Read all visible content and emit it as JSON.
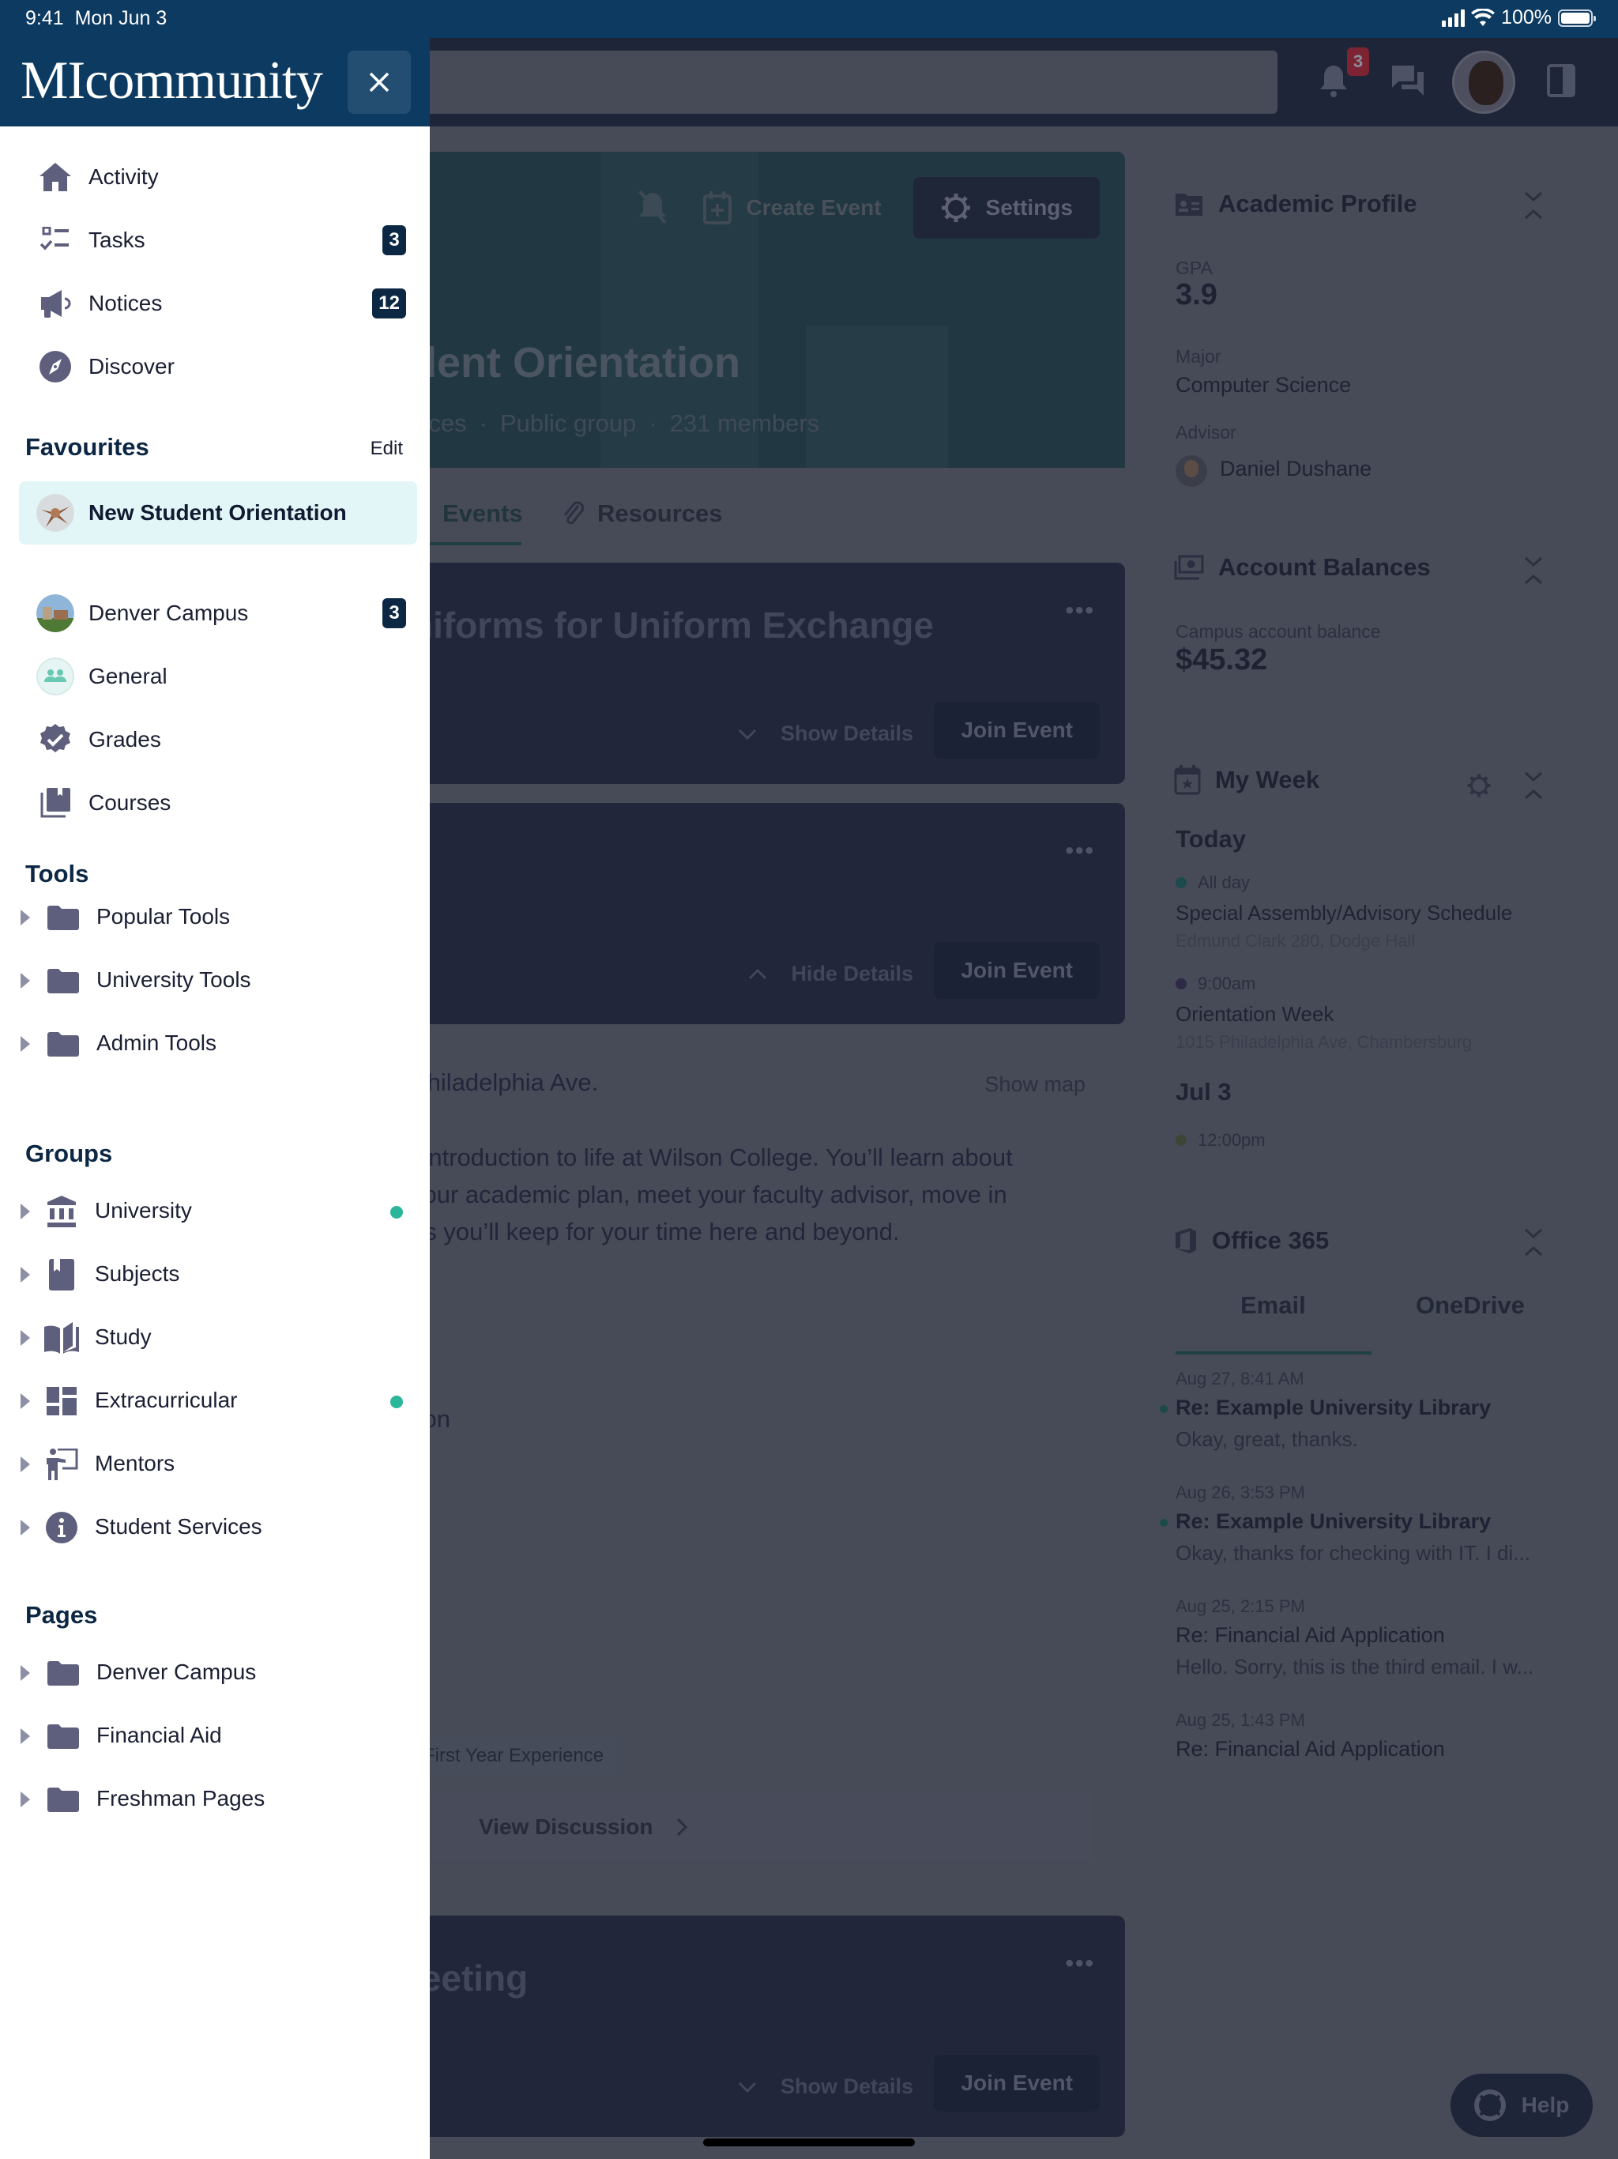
{
  "status_bar": {
    "time": "9:41",
    "date": "Mon Jun 3",
    "battery": "100%"
  },
  "drawer": {
    "brand": "MIcommunity",
    "close_label": "Close",
    "nav": [
      {
        "label": "Activity",
        "icon": "home-icon"
      },
      {
        "label": "Tasks",
        "icon": "task-list-icon",
        "badge": "3"
      },
      {
        "label": "Notices",
        "icon": "megaphone-icon",
        "badge": "12"
      },
      {
        "label": "Discover",
        "icon": "compass-icon"
      }
    ],
    "favourites": {
      "title": "Favourites",
      "edit_label": "Edit",
      "items": [
        {
          "label": "New Student Orientation",
          "icon": "group-photo-avatar",
          "active": true
        },
        {
          "label": "Denver Campus",
          "icon": "campus-photo-avatar",
          "badge": "3"
        },
        {
          "label": "General",
          "icon": "people-icon"
        },
        {
          "label": "Grades",
          "icon": "verified-badge-icon"
        },
        {
          "label": "Courses",
          "icon": "library-books-icon"
        }
      ]
    },
    "tools": {
      "title": "Tools",
      "items": [
        {
          "label": "Popular Tools",
          "icon": "folder-icon"
        },
        {
          "label": "University Tools",
          "icon": "folder-icon"
        },
        {
          "label": "Admin Tools",
          "icon": "folder-icon"
        }
      ]
    },
    "groups": {
      "title": "Groups",
      "items": [
        {
          "label": "University",
          "icon": "institution-icon",
          "dot": true
        },
        {
          "label": "Subjects",
          "icon": "bookmark-book-icon"
        },
        {
          "label": "Study",
          "icon": "open-book-icon"
        },
        {
          "label": "Extracurricular",
          "icon": "dashboard-icon",
          "dot": true
        },
        {
          "label": "Mentors",
          "icon": "presenter-icon"
        },
        {
          "label": "Student Services",
          "icon": "info-icon"
        }
      ]
    },
    "pages": {
      "title": "Pages",
      "items": [
        {
          "label": "Denver Campus",
          "icon": "folder-icon"
        },
        {
          "label": "Financial Aid",
          "icon": "folder-icon"
        },
        {
          "label": "Freshman Pages",
          "icon": "folder-icon"
        }
      ]
    }
  },
  "topbar": {
    "notification_count": "3"
  },
  "group_page": {
    "create_event_label": "Create Event",
    "settings_label": "Settings",
    "title_visible": "dent Orientation",
    "meta": {
      "category_visible": "vices",
      "visibility": "Public group",
      "members": "231 members"
    },
    "tabs": [
      {
        "label": "Events",
        "active": true
      },
      {
        "label": "Resources"
      }
    ],
    "events": [
      {
        "title_visible": "niforms for Uniform Exchange",
        "details_label": "Show Details",
        "join_label": "Join Event"
      },
      {
        "title_visible": "",
        "details_label": "Hide Details",
        "join_label": "Join Event"
      },
      {
        "title_visible": "leeting",
        "details_label": "Show Details",
        "join_label": "Join Event"
      }
    ],
    "event_detail": {
      "location_visible": "Philadelphia Ave.",
      "show_map_label": "Show map",
      "description_lines": [
        "l introduction to life at Wilson College. You’ll learn about",
        " your academic plan, meet your faculty advisor, move in",
        "ds you’ll keep for your time here and beyond."
      ],
      "fragment_visible": "tion",
      "tag": "First Year Experience",
      "view_discussion_label": "View Discussion"
    }
  },
  "widgets": {
    "academic_profile": {
      "title": "Academic Profile",
      "gpa_label": "GPA",
      "gpa": "3.9",
      "major_label": "Major",
      "major": "Computer Science",
      "advisor_label": "Advisor",
      "advisor": "Daniel Dushane"
    },
    "account_balances": {
      "title": "Account Balances",
      "balance_label": "Campus account balance",
      "balance": "$45.32"
    },
    "my_week": {
      "title": "My Week",
      "days": [
        {
          "heading": "Today",
          "events": [
            {
              "time": "All day",
              "title": "Special Assembly/Advisory Schedule",
              "location": "Edmund Clark 280, Dodge Hall",
              "color": "#1d4a4d"
            },
            {
              "time": "9:00am",
              "title": "Orientation Week",
              "location": "1015 Philadelphia Ave, Chambersburg",
              "color": "#2e2944"
            }
          ]
        },
        {
          "heading": "Jul 3",
          "events": [
            {
              "time": "12:00pm",
              "color": "#3e4536"
            }
          ]
        }
      ]
    },
    "office365": {
      "title": "Office 365",
      "tabs": [
        {
          "label": "Email",
          "active": true
        },
        {
          "label": "OneDrive"
        }
      ],
      "emails": [
        {
          "time": "Aug 27, 8:41 AM",
          "subject": "Re: Example University Library",
          "preview": "Okay, great, thanks.",
          "unread": true
        },
        {
          "time": "Aug 26, 3:53 PM",
          "subject": "Re: Example University Library",
          "preview": "Okay, thanks for checking with IT. I di...",
          "unread": true
        },
        {
          "time": "Aug 25, 2:15 PM",
          "subject": "Re: Financial Aid Application",
          "preview": "Hello. Sorry, this is the third email. I w...",
          "unread": false
        },
        {
          "time": "Aug 25, 1:43 PM",
          "subject": "Re: Financial Aid Application",
          "preview": "",
          "unread": false
        }
      ]
    }
  },
  "help_label": "Help",
  "colors": {
    "brand_navy": "#0d3a60",
    "badge_navy": "#0b2743",
    "active_bg": "#e3f6f7",
    "status_green": "#2bb59a",
    "icon_gray": "#5d5f7d"
  }
}
